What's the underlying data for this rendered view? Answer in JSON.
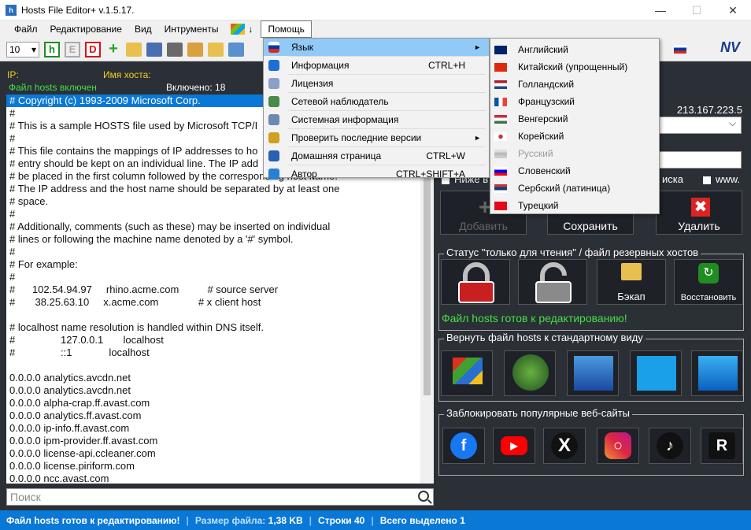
{
  "window": {
    "title": "Hosts File Editor+ v.1.5.17.",
    "app_icon": "h"
  },
  "menubar": {
    "items": [
      "Файл",
      "Редактирование",
      "Вид",
      "Интрументы"
    ],
    "flag_menu": "↓",
    "help": "Помощь"
  },
  "toolbar": {
    "font_size": "10",
    "h_label": "h",
    "e_label": "E",
    "d_label": "D",
    "plus": "+",
    "logo": "NV"
  },
  "left": {
    "ip_label": "IP:",
    "host_label": "Имя хоста:",
    "status": "Файл hosts включен",
    "count": "Включено: 18",
    "lines": [
      "# Copyright (c) 1993-2009 Microsoft Corp.",
      "#",
      "# This is a sample HOSTS file used by Microsoft TCP/I",
      "#",
      "# This file contains the mappings of IP addresses to ho",
      "# entry should be kept on an individual line. The IP add",
      "# be placed in the first column followed by the corresponding host name.",
      "# The IP address and the host name should be separated by at least one",
      "# space.",
      "#",
      "# Additionally, comments (such as these) may be inserted on individual",
      "# lines or following the machine name denoted by a '#' symbol.",
      "#",
      "# For example:",
      "#",
      "#      102.54.94.97     rhino.acme.com          # source server",
      "#       38.25.63.10     x.acme.com              # x client host",
      "",
      "# localhost name resolution is handled within DNS itself.",
      "#                127.0.0.1       localhost",
      "#                ::1             localhost",
      "",
      "0.0.0.0 analytics.avcdn.net",
      "0.0.0.0 analytics.avcdn.net",
      "0.0.0.0 alpha-crap.ff.avast.com",
      "0.0.0.0 analytics.ff.avast.com",
      "0.0.0.0 ip-info.ff.avast.com",
      "0.0.0.0 ipm-provider.ff.avast.com",
      "0.0.0.0 license-api.ccleaner.com",
      "0.0.0.0 license.piriform.com",
      "0.0.0.0 ncc.avast.com"
    ],
    "search_placeholder": "Поиск"
  },
  "right": {
    "ip_address": "213.167.223.5",
    "opt_below": "Ниже в",
    "opt_search": "иска",
    "opt_www": "www.",
    "btn_add": "Добавить",
    "btn_save": "Сохранить",
    "btn_delete": "Удалить",
    "group_readonly": "Статус \"только для чтения\" / файл резервных хостов",
    "btn_backup": "Бэкап",
    "btn_restore": "Восстановить",
    "ready_status": "Файл hosts готов к редактированию!",
    "group_default": "Вернуть файл hosts к стандартному виду",
    "win_labels": [
      "Windows XP",
      "Vista",
      "Windows 7",
      "Windows 8",
      "Windows 10, 11"
    ],
    "group_block": "Заблокировать популярные веб-сайты",
    "sites": [
      "facebook-icon",
      "youtube-icon",
      "x-icon",
      "instagram-icon",
      "tiktok-icon",
      "rutube-icon"
    ]
  },
  "statusbar": {
    "status": "Файл hosts готов к редактированию!",
    "size_label": "Размер файла:",
    "size_value": "1,38 KB",
    "lines_label": "Строки",
    "lines_value": "40",
    "selected_label": "Всего выделено",
    "selected_value": "1"
  },
  "help_menu": {
    "items": [
      {
        "label": "Язык",
        "shortcut": "",
        "arrow": "►",
        "icon": "flag-ru-icon"
      },
      {
        "label": "Информация",
        "shortcut": "CTRL+H",
        "arrow": "",
        "icon": "info-icon"
      },
      {
        "label": "Лицензия",
        "shortcut": "",
        "arrow": "",
        "icon": "license-icon"
      },
      {
        "label": "Сетевой наблюдатель",
        "shortcut": "",
        "arrow": "",
        "icon": "network-icon"
      },
      {
        "label": "Системная информация",
        "shortcut": "",
        "arrow": "",
        "icon": "system-info-icon"
      },
      {
        "label": "Проверить последние версии",
        "shortcut": "",
        "arrow": "►",
        "icon": "update-icon"
      },
      {
        "label": "Домашняя страница",
        "shortcut": "CTRL+W",
        "arrow": "",
        "icon": "globe-icon"
      },
      {
        "label": "Автор",
        "shortcut": "CTRL+SHIFT+A",
        "arrow": "",
        "icon": "author-icon"
      }
    ]
  },
  "language_menu": {
    "items": [
      {
        "label": "Английский",
        "flag": "gb"
      },
      {
        "label": "Китайский (упрощенный)",
        "flag": "cn"
      },
      {
        "label": "Голландский",
        "flag": "nl"
      },
      {
        "label": "Французский",
        "flag": "fr"
      },
      {
        "label": "Венгерский",
        "flag": "hu"
      },
      {
        "label": "Корейский",
        "flag": "kr"
      },
      {
        "label": "Русский",
        "flag": "ru"
      },
      {
        "label": "Словенский",
        "flag": "si"
      },
      {
        "label": "Сербский (латиница)",
        "flag": "rs"
      },
      {
        "label": "Турецкий",
        "flag": "tr"
      }
    ]
  },
  "colors": {
    "accent_blue": "#0a78d7",
    "panel_dark": "#2b2f36",
    "status_green": "#45e045",
    "label_yellow": "#f0d020"
  }
}
